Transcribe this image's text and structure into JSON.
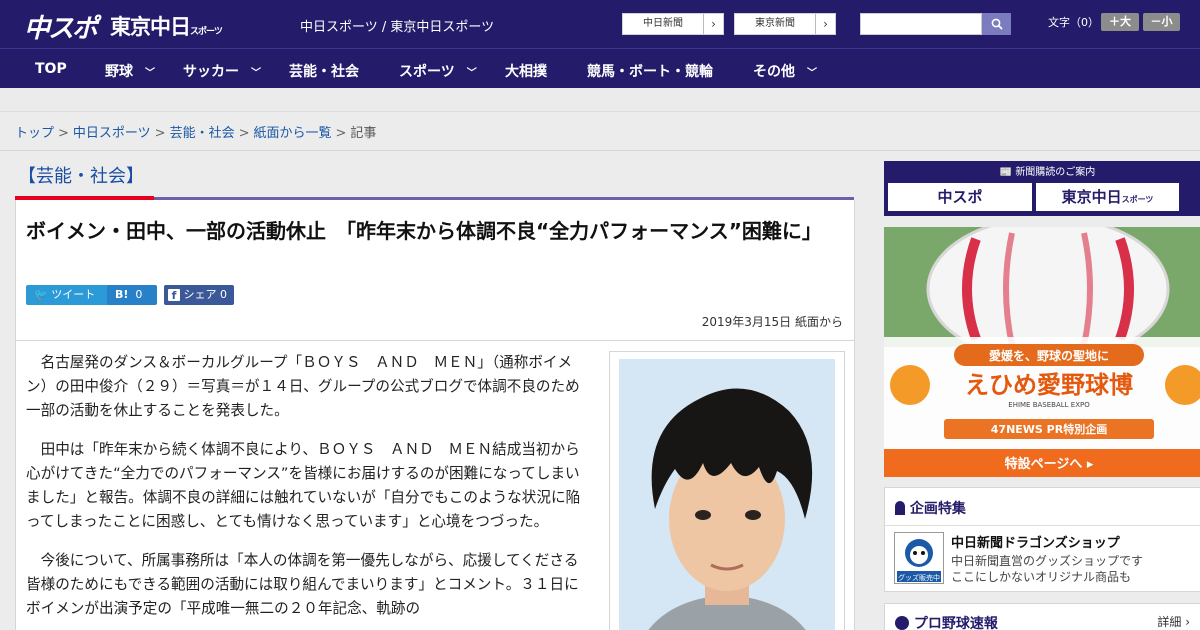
{
  "header": {
    "logo_chunichi_sports": "中スポ",
    "logo_tokyo_chunichi": "東京中日",
    "logo_tokyo_sports": "スポーツ",
    "site_name": "中日スポーツ / 東京中日スポーツ",
    "chunichi_shimbun_link": "中日新聞",
    "tokyo_shimbun_link": "東京新聞",
    "search_placeholder": "",
    "text_size_label": "文字（0）",
    "text_size_plus": "＋大",
    "text_size_minus": "－小"
  },
  "nav": {
    "items": [
      "TOP",
      "野球",
      "サッカー",
      "芸能・社会",
      "スポーツ",
      "大相撲",
      "競馬・ボート・競輪",
      "その他"
    ]
  },
  "breadcrumb": {
    "items": [
      "トップ",
      "中日スポーツ",
      "芸能・社会",
      "紙面から一覧"
    ],
    "current": "記事",
    "separator": ">"
  },
  "category": {
    "label": "【芸能・社会】"
  },
  "article": {
    "title": "ボイメン・田中、一部の活動休止　「昨年末から体調不良“全力パフォーマンス”困難に」",
    "share": {
      "tweet": "ツイート",
      "hatena_icon": "B!",
      "hatena_count": "0",
      "facebook_label": "シェア",
      "facebook_count": "0"
    },
    "date": "2019年3月15日 紙面から",
    "paragraphs": [
      "名古屋発のダンス＆ボーカルグループ「ＢＯＹＳ　ＡＮＤ　ＭＥＮ」（通称ボイメン）の田中俊介（２９）＝写真＝が１４日、グループの公式ブログで体調不良のため一部の活動を休止することを発表した。",
      "田中は「昨年末から続く体調不良により、ＢＯＹＳ　ＡＮＤ　ＭＥＮ結成当初から心がけてきた“全力でのパフォーマンス”を皆様にお届けするのが困難になってしまいました」と報告。体調不良の詳細には触れていないが「自分でもこのような状況に陥ってしまったことに困惑し、とても情けなく思っています」と心境をつづった。",
      "今後について、所属事務所は「本人の体調を第一優先しながら、応援してくださる皆様のためにもできる範囲の活動には取り組んでまいります」とコメント。３１日にボイメンが出演予定の「平成唯一無二の２０年記念、軌跡の"
    ]
  },
  "sidebar": {
    "subscribe": {
      "title": "新聞購読のご案内",
      "chunichi": "中スポ",
      "tokyo": "東京中日",
      "tokyo_small": "スポーツ"
    },
    "ad": {
      "headline": "愛媛を、野球の聖地に",
      "logo": "えひめ愛野球博",
      "logo_en": "EHIME BASEBALL EXPO",
      "pr": "47NEWS PR特別企画",
      "cta": "特設ページへ ▸"
    },
    "kikaku": {
      "title": "企画特集",
      "item_title": "中日新聞ドラゴンズショップ",
      "item_desc_1": "中日新聞直営のグッズショップです",
      "item_desc_2": "ここにしかないオリジナル商品も",
      "shop_badge": "グッズ販売中"
    },
    "baseball": {
      "title": "プロ野球速報",
      "more": "詳細 ›"
    }
  }
}
